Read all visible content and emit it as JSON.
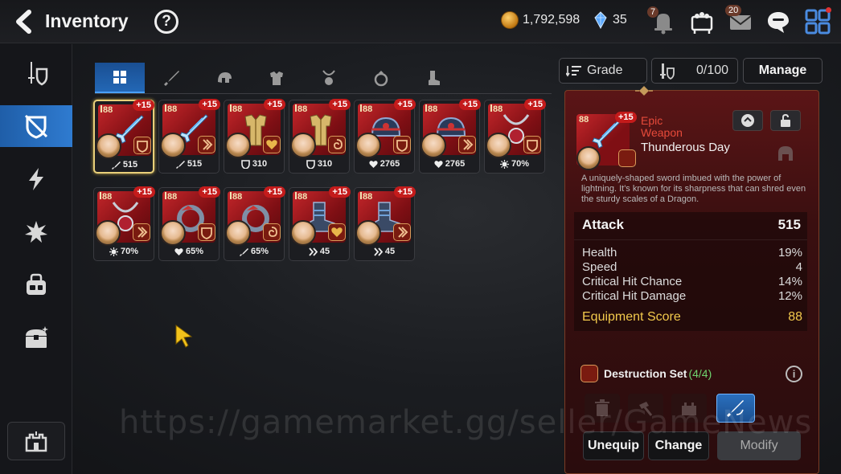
{
  "header": {
    "title": "Inventory",
    "help_icon": "?",
    "gold": "1,792,598",
    "gems": "35",
    "notice_badge": "7",
    "mail_badge": "20"
  },
  "sidebar": {
    "items": [
      {
        "name": "sword-shield-icon",
        "active": false
      },
      {
        "name": "shield-slash-icon",
        "active": true
      },
      {
        "name": "lightning-icon",
        "active": false
      },
      {
        "name": "burst-icon",
        "active": false
      },
      {
        "name": "bag-icon",
        "active": false
      },
      {
        "name": "chest-icon",
        "active": false
      }
    ],
    "bottom": "castle-icon"
  },
  "tabs": [
    {
      "name": "all-grid-icon",
      "active": true
    },
    {
      "name": "weapon-icon",
      "active": false
    },
    {
      "name": "helmet-icon",
      "active": false
    },
    {
      "name": "armor-icon",
      "active": false
    },
    {
      "name": "necklace-icon",
      "active": false
    },
    {
      "name": "ring-icon",
      "active": false
    },
    {
      "name": "boots-icon",
      "active": false
    }
  ],
  "inventory": [
    {
      "level": "88",
      "plus": "+15",
      "stat_type": "sword",
      "stat": "515",
      "gear": "sword",
      "selected": true,
      "set": "destruction"
    },
    {
      "level": "88",
      "plus": "+15",
      "stat_type": "sword",
      "stat": "515",
      "gear": "sword",
      "selected": false,
      "set": "attack"
    },
    {
      "level": "88",
      "plus": "+15",
      "stat_type": "shield",
      "stat": "310",
      "gear": "armor",
      "selected": false,
      "set": "heart"
    },
    {
      "level": "88",
      "plus": "+15",
      "stat_type": "shield",
      "stat": "310",
      "gear": "armor",
      "selected": false,
      "set": "swirl"
    },
    {
      "level": "88",
      "plus": "+15",
      "stat_type": "heart",
      "stat": "2765",
      "gear": "helmet",
      "selected": false,
      "set": "destruction"
    },
    {
      "level": "88",
      "plus": "+15",
      "stat_type": "heart",
      "stat": "2765",
      "gear": "helmet",
      "selected": false,
      "set": "attack"
    },
    {
      "level": "88",
      "plus": "+15",
      "stat_type": "crit",
      "stat": "70%",
      "gear": "necklace",
      "selected": false,
      "set": "destruction"
    },
    {
      "level": "88",
      "plus": "+15",
      "stat_type": "crit",
      "stat": "70%",
      "gear": "necklace",
      "selected": false,
      "set": "attack"
    },
    {
      "level": "88",
      "plus": "+15",
      "stat_type": "heart",
      "stat": "65%",
      "gear": "ring",
      "selected": false,
      "set": "destruction"
    },
    {
      "level": "88",
      "plus": "+15",
      "stat_type": "sword",
      "stat": "65%",
      "gear": "ring",
      "selected": false,
      "set": "swirl"
    },
    {
      "level": "88",
      "plus": "+15",
      "stat_type": "speed",
      "stat": "45",
      "gear": "boots",
      "selected": false,
      "set": "heart"
    },
    {
      "level": "88",
      "plus": "+15",
      "stat_type": "speed",
      "stat": "45",
      "gear": "boots",
      "selected": false,
      "set": "attack"
    }
  ],
  "controls": {
    "grade_label": "Grade",
    "capacity": "0/100",
    "manage_label": "Manage"
  },
  "detail": {
    "level": "88",
    "plus": "+15",
    "grade_line1": "Epic",
    "grade_line2": "Weapon",
    "name": "Thunderous Day",
    "description": "A uniquely-shaped sword imbued with the power of lightning. It's known for its sharpness that can shred even the sturdy scales of a Dragon.",
    "main_stat_label": "Attack",
    "main_stat_value": "515",
    "sub_stats": [
      {
        "label": "Health",
        "value": "19%"
      },
      {
        "label": "Speed",
        "value": "4"
      },
      {
        "label": "Critical Hit Chance",
        "value": "14%"
      },
      {
        "label": "Critical Hit Damage",
        "value": "12%"
      }
    ],
    "score_label": "Equipment Score",
    "score_value": "88",
    "set_name": "Destruction Set",
    "set_count": "(4/4)",
    "info_icon": "i",
    "unequip_label": "Unequip",
    "change_label": "Change",
    "modify_label": "Modify"
  },
  "watermark": "https://gamemarket.gg/seller/GameNews",
  "colors": {
    "accent_blue": "#2f7bd0",
    "epic_red": "#e64a3a",
    "score_gold": "#f2c94c",
    "set_green": "#6ed36e"
  }
}
